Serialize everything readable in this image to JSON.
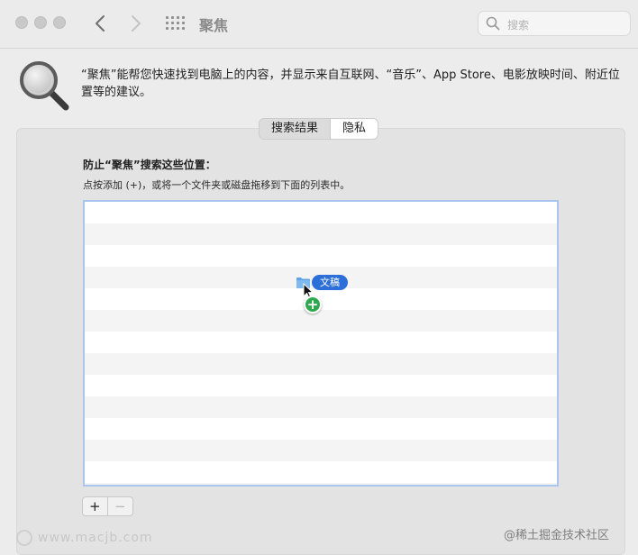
{
  "window": {
    "title": "聚焦"
  },
  "search": {
    "placeholder": "搜索"
  },
  "header": {
    "description": "“聚焦”能帮您快速找到电脑上的内容，并显示来自互联网、“音乐”、App Store、电影放映时间、附近位置等的建议。"
  },
  "tabs": [
    {
      "label": "搜索结果",
      "active": false
    },
    {
      "label": "隐私",
      "active": true
    }
  ],
  "privacy": {
    "title": "防止“聚焦”搜索这些位置：",
    "subtitle": "点按添加 (+)，或将一个文件夹或磁盘拖移到下面的列表中。",
    "list_items": [],
    "drag_item": {
      "label": "文稿",
      "icon": "folder-icon"
    }
  },
  "buttons": {
    "add": "+",
    "remove": "−"
  },
  "watermark": {
    "left": "www.macjb.com",
    "right": "@稀土掘金技术社区"
  },
  "colors": {
    "accent": "#2d6fd8",
    "add_badge": "#2fa84f",
    "list_focus": "#a9c7ee"
  }
}
